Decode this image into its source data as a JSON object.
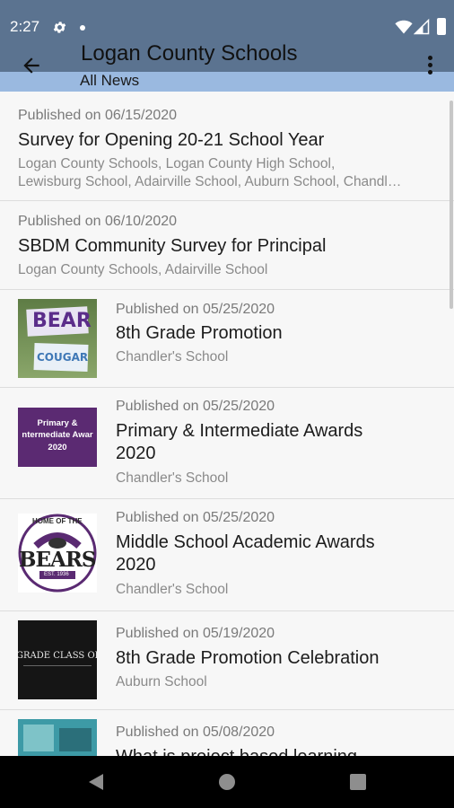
{
  "status": {
    "time": "2:27"
  },
  "header": {
    "title": "Logan County Schools",
    "subtitle": "All News"
  },
  "news": [
    {
      "date": "Published on 06/15/2020",
      "title": "Survey for Opening 20-21 School Year",
      "schools_line1": "Logan County Schools, Logan County High School,",
      "schools_line2": "Lewisburg School, Adairville School, Auburn School, Chandl…"
    },
    {
      "date": "Published on 06/10/2020",
      "title": "SBDM Community Survey for Principal",
      "schools": "Logan County Schools, Adairville School"
    },
    {
      "date": "Published on 05/25/2020",
      "title": "8th Grade Promotion",
      "schools": "Chandler's School",
      "thumb_text_top": "BEAR",
      "thumb_text_bottom": "COUGAR"
    },
    {
      "date": "Published on 05/25/2020",
      "title_line1": "Primary & Intermediate Awards",
      "title_line2": "2020",
      "schools": "Chandler's School",
      "thumb_text_1": "Primary &",
      "thumb_text_2": "ntermediate Awar",
      "thumb_text_3": "2020"
    },
    {
      "date": "Published on 05/25/2020",
      "title_line1": "Middle School Academic Awards",
      "title_line2": "2020",
      "schools": "Chandler's School",
      "thumb_text_1": "HOME OF THE",
      "thumb_text_2": "BEARS",
      "thumb_text_3": "EST. 1936"
    },
    {
      "date": "Published on 05/19/2020",
      "title": "8th Grade Promotion Celebration",
      "schools": "Auburn School",
      "thumb_text": "GRADE CLASS OF"
    },
    {
      "date": "Published on 05/08/2020",
      "title": "What is project based learning"
    }
  ],
  "colors": {
    "appbar": "#5b7390",
    "subbar": "#9ab9e0",
    "purple": "#5a2a72"
  },
  "icons": [
    "settings-icon",
    "wifi-icon",
    "signal-icon",
    "battery-icon",
    "back-arrow-icon",
    "more-vert-icon",
    "nav-back-icon",
    "nav-home-icon",
    "nav-recents-icon"
  ]
}
